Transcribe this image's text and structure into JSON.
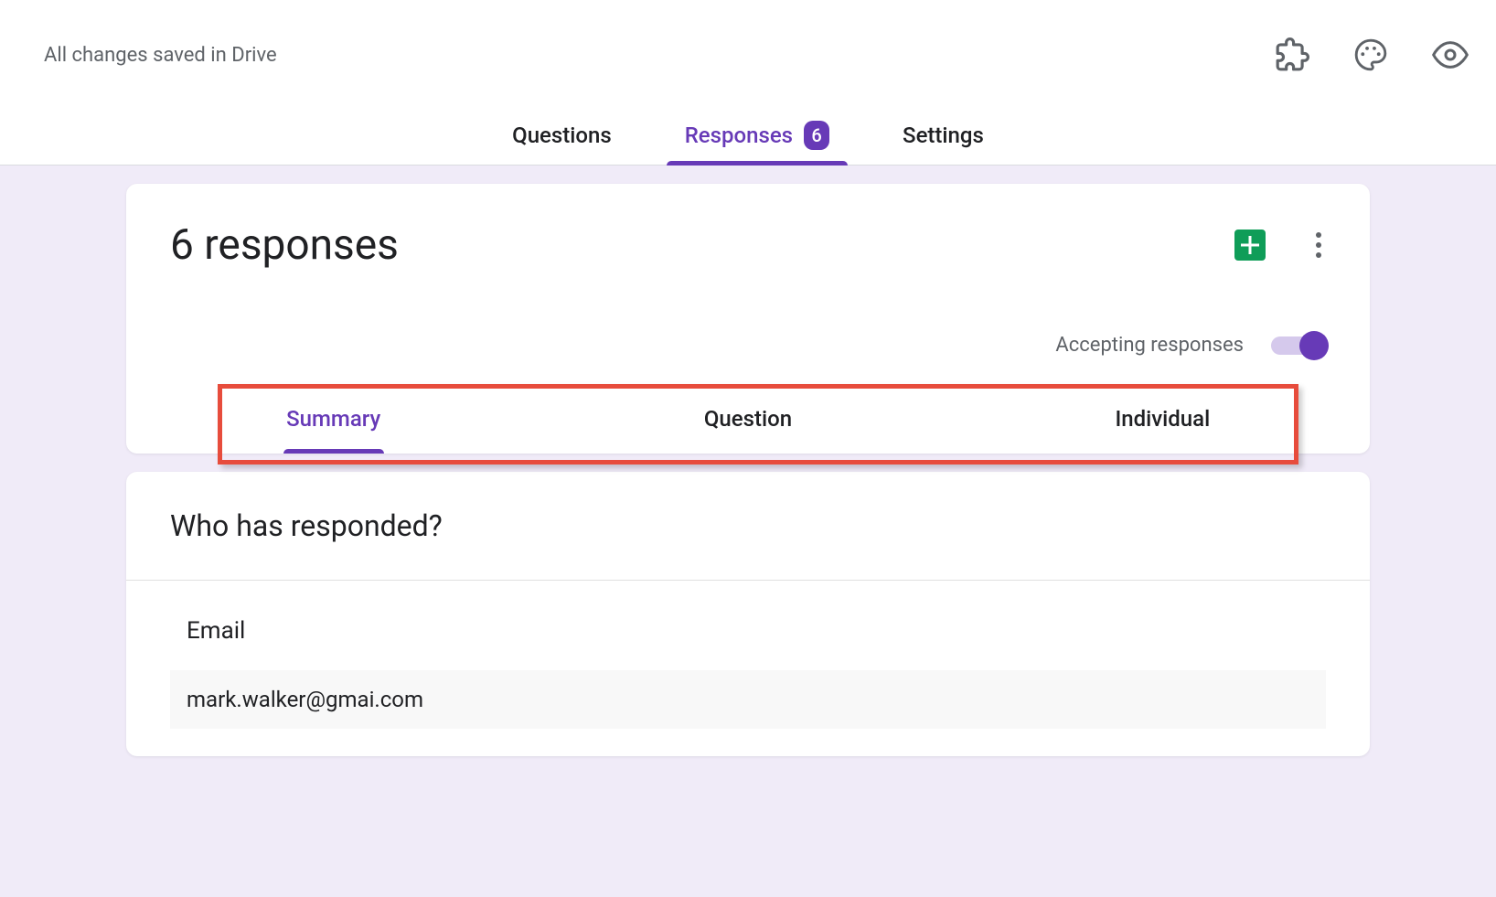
{
  "header": {
    "save_status": "All changes saved in Drive"
  },
  "main_tabs": {
    "questions": "Questions",
    "responses": "Responses",
    "responses_count": "6",
    "settings": "Settings"
  },
  "responses": {
    "title": "6 responses",
    "accepting_label": "Accepting responses"
  },
  "sub_tabs": {
    "summary": "Summary",
    "question": "Question",
    "individual": "Individual"
  },
  "responded": {
    "title": "Who has responded?",
    "email_label": "Email",
    "emails": [
      "mark.walker@gmai.com"
    ]
  }
}
